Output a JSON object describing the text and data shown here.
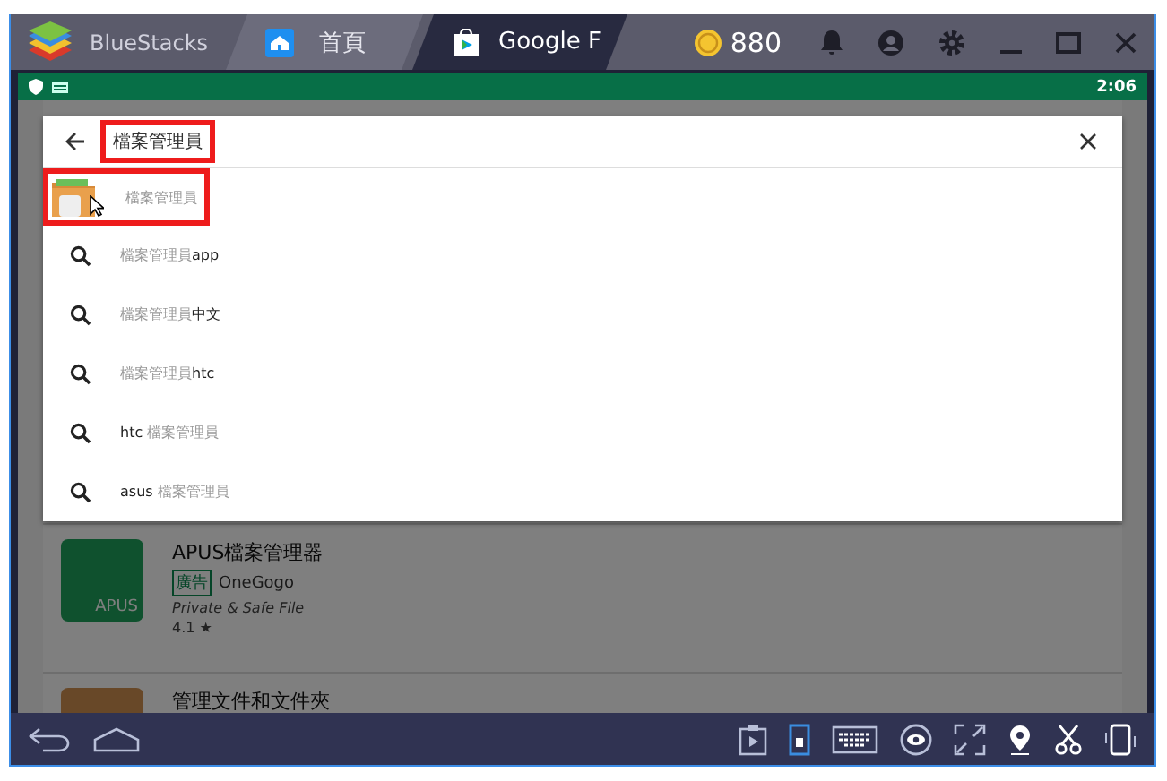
{
  "window": {
    "app_name": "BlueStacks",
    "tabs": [
      {
        "label": "首頁",
        "kind": "home",
        "selected": false
      },
      {
        "label": "Google F",
        "kind": "play",
        "selected": true
      }
    ],
    "coins": "880"
  },
  "status_bar": {
    "time": "2:06"
  },
  "search": {
    "query": "檔案管理員",
    "highlighted": true,
    "suggestions": [
      {
        "kind": "app",
        "highlighted": true,
        "segments": [
          {
            "text": "檔案管理員",
            "matched": true
          }
        ]
      },
      {
        "kind": "query",
        "highlighted": false,
        "segments": [
          {
            "text": "檔案管理員",
            "matched": true
          },
          {
            "text": "app",
            "matched": false
          }
        ]
      },
      {
        "kind": "query",
        "highlighted": false,
        "segments": [
          {
            "text": "檔案管理員",
            "matched": true
          },
          {
            "text": "中文",
            "matched": false
          }
        ]
      },
      {
        "kind": "query",
        "highlighted": false,
        "segments": [
          {
            "text": "檔案管理員",
            "matched": true
          },
          {
            "text": "htc",
            "matched": false
          }
        ]
      },
      {
        "kind": "query",
        "highlighted": false,
        "segments": [
          {
            "text": "htc ",
            "matched": false
          },
          {
            "text": "檔案管理員",
            "matched": true
          }
        ]
      },
      {
        "kind": "query",
        "highlighted": false,
        "segments": [
          {
            "text": "asus ",
            "matched": false
          },
          {
            "text": "檔案管理員",
            "matched": true
          }
        ]
      }
    ]
  },
  "results": [
    {
      "title": "APUS檔案管理器",
      "ad_tag": "廣告",
      "developer": "OneGogo",
      "tagline": "Private & Safe File",
      "rating": "4.1 ★",
      "icon_label": "APUS",
      "kind": "green"
    },
    {
      "title": "管理文件和文件夾",
      "kind": "folder"
    }
  ]
}
